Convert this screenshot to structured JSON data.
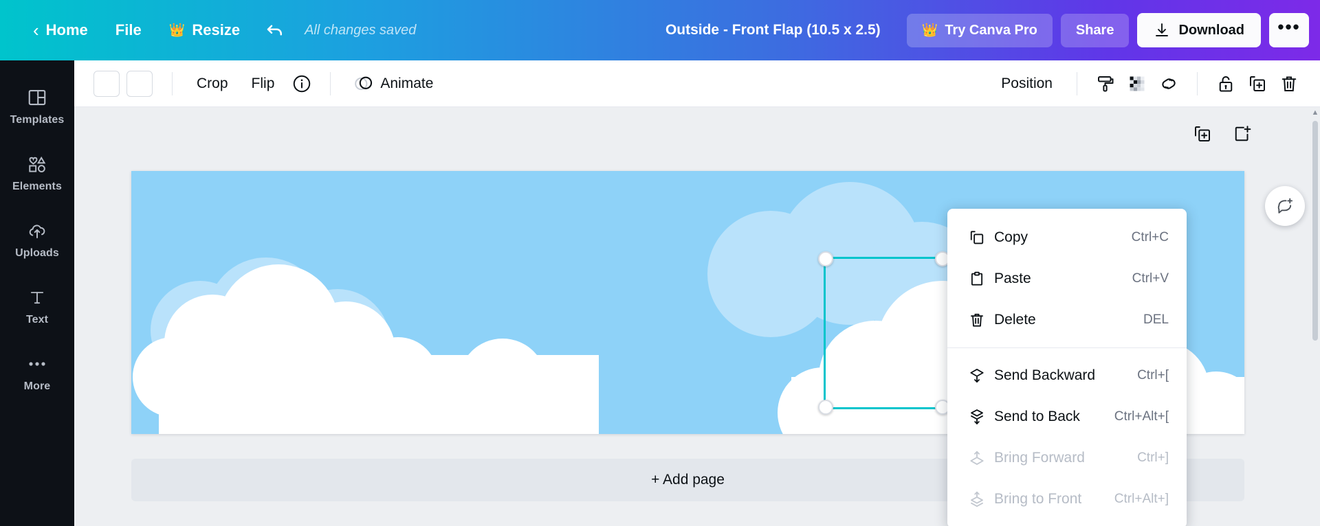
{
  "header": {
    "back_icon": "chevron-left-icon",
    "home_label": "Home",
    "file_label": "File",
    "resize_label": "Resize",
    "resize_icon": "crown-icon",
    "undo_icon": "undo-arrow-icon",
    "save_status": "All changes saved",
    "doc_title": "Outside - Front Flap (10.5 x 2.5)",
    "pro_label": "Try Canva Pro",
    "pro_icon": "crown-icon",
    "share_label": "Share",
    "download_label": "Download",
    "download_icon": "download-arrow-icon",
    "more_label": "•••",
    "gradient_start": "#00c4cc",
    "gradient_end": "#7d2ae8"
  },
  "sidebar": {
    "items": [
      {
        "label": "Templates",
        "icon": "templates-icon"
      },
      {
        "label": "Elements",
        "icon": "elements-icon"
      },
      {
        "label": "Uploads",
        "icon": "uploads-cloud-icon"
      },
      {
        "label": "Text",
        "icon": "text-t-icon"
      },
      {
        "label": "More",
        "icon": "more-dots-icon"
      }
    ],
    "background": "#0d1117"
  },
  "toolbar": {
    "swatch_one": "color-swatch-white",
    "swatch_two": "color-swatch-white",
    "crop_label": "Crop",
    "flip_label": "Flip",
    "info_icon": "info-circle-icon",
    "animate_icon": "animate-circles-icon",
    "animate_label": "Animate",
    "position_label": "Position",
    "right_icons": [
      "paint-roller-icon",
      "transparency-checker-icon",
      "link-icon",
      "lock-icon",
      "duplicate-icon",
      "trash-icon"
    ]
  },
  "canvas": {
    "page_tools": [
      "duplicate-page-icon",
      "add-page-icon"
    ],
    "page_background": "#8ed2f8",
    "cloud_color": "#ffffff",
    "selection_color": "#00c4cc",
    "rotate_icon": "rotate-icon",
    "add_page_label": "+ Add page",
    "comment_icon": "add-comment-icon"
  },
  "context_menu": {
    "groups": [
      {
        "items": [
          {
            "label": "Copy",
            "shortcut": "Ctrl+C",
            "icon": "copy-icon",
            "disabled": false
          },
          {
            "label": "Paste",
            "shortcut": "Ctrl+V",
            "icon": "paste-icon",
            "disabled": false
          },
          {
            "label": "Delete",
            "shortcut": "DEL",
            "icon": "trash-icon",
            "disabled": false
          }
        ]
      },
      {
        "items": [
          {
            "label": "Send Backward",
            "shortcut": "Ctrl+[",
            "icon": "send-backward-icon",
            "disabled": false
          },
          {
            "label": "Send to Back",
            "shortcut": "Ctrl+Alt+[",
            "icon": "send-to-back-icon",
            "disabled": false
          },
          {
            "label": "Bring Forward",
            "shortcut": "Ctrl+]",
            "icon": "bring-forward-icon",
            "disabled": true
          },
          {
            "label": "Bring to Front",
            "shortcut": "Ctrl+Alt+]",
            "icon": "bring-to-front-icon",
            "disabled": true
          }
        ]
      }
    ]
  },
  "scrollbar": {
    "up_arrow": "▲",
    "down_arrow": "▼"
  }
}
